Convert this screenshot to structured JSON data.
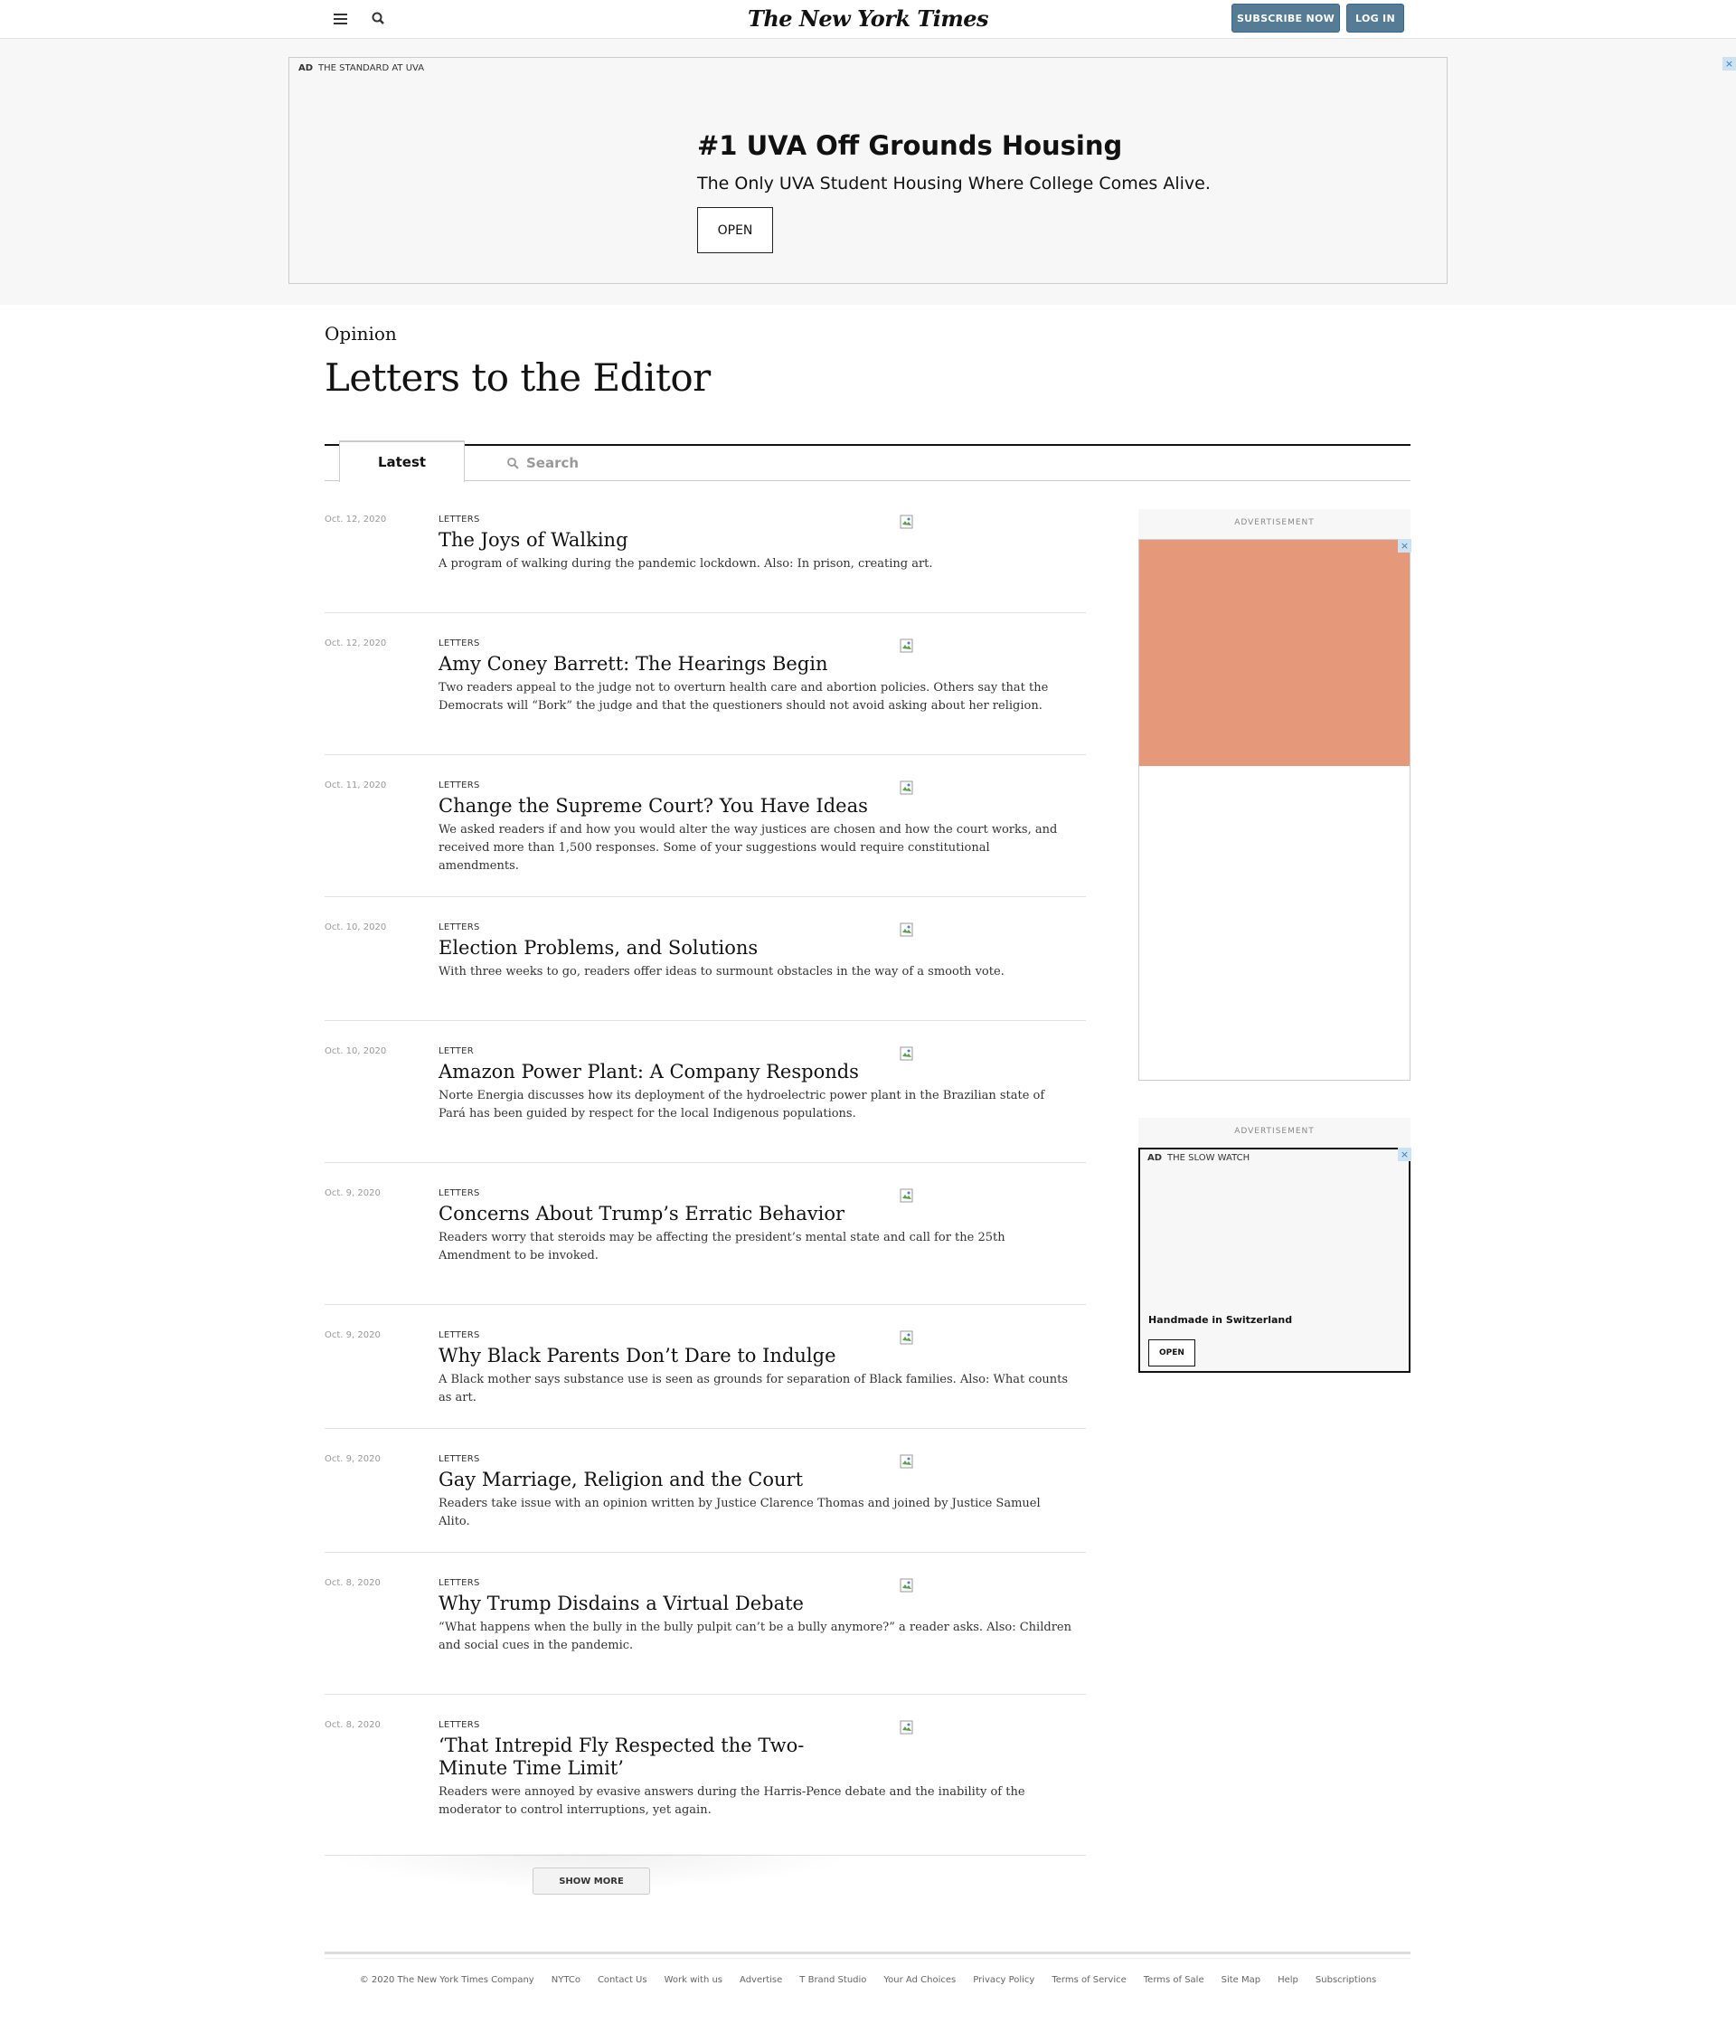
{
  "header": {
    "masthead": "The New York Times",
    "subscribe_label": "SUBSCRIBE NOW",
    "login_label": "LOG IN"
  },
  "top_ad": {
    "ad_tag": "AD",
    "advertiser": "THE STANDARD AT UVA",
    "headline": "#1 UVA Off Grounds Housing",
    "subline": "The Only UVA Student Housing Where College Comes Alive.",
    "cta": "OPEN",
    "close": "×"
  },
  "section": {
    "kicker": "Opinion",
    "title": "Letters to the Editor"
  },
  "tabs": {
    "latest": "Latest",
    "search_placeholder": "Search"
  },
  "articles": [
    {
      "date": "Oct. 12, 2020",
      "kicker": "LETTERS",
      "title": "The Joys of Walking",
      "summary": "A program of walking during the pandemic lockdown. Also: In prison, creating art."
    },
    {
      "date": "Oct. 12, 2020",
      "kicker": "LETTERS",
      "title": "Amy Coney Barrett: The Hearings Begin",
      "summary": "Two readers appeal to the judge not to overturn health care and abortion policies. Others say that the Democrats will “Bork” the judge and that the questioners should not avoid asking about her religion."
    },
    {
      "date": "Oct. 11, 2020",
      "kicker": "LETTERS",
      "title": "Change the Supreme Court? You Have Ideas",
      "summary": "We asked readers if and how you would alter the way justices are chosen and how the court works, and received more than 1,500 responses. Some of your suggestions would require constitutional amendments."
    },
    {
      "date": "Oct. 10, 2020",
      "kicker": "LETTERS",
      "title": "Election Problems, and Solutions",
      "summary": "With three weeks to go, readers offer ideas to surmount obstacles in the way of a smooth vote."
    },
    {
      "date": "Oct. 10, 2020",
      "kicker": "LETTER",
      "title": "Amazon Power Plant: A Company Responds",
      "summary": "Norte Energia discusses how its deployment of the hydroelectric power plant in the Brazilian state of Pará has been guided by respect for the local Indigenous populations."
    },
    {
      "date": "Oct. 9, 2020",
      "kicker": "LETTERS",
      "title": "Concerns About Trump’s Erratic Behavior",
      "summary": "Readers worry that steroids may be affecting the president’s mental state and call for the 25th Amendment to be invoked."
    },
    {
      "date": "Oct. 9, 2020",
      "kicker": "LETTERS",
      "title": "Why Black Parents Don’t Dare to Indulge",
      "summary": "A Black mother says substance use is seen as grounds for separation of Black families. Also: What counts as art."
    },
    {
      "date": "Oct. 9, 2020",
      "kicker": "LETTERS",
      "title": "Gay Marriage, Religion and the Court",
      "summary": "Readers take issue with an opinion written by Justice Clarence Thomas and joined by Justice Samuel Alito."
    },
    {
      "date": "Oct. 8, 2020",
      "kicker": "LETTERS",
      "title": "Why Trump Disdains a Virtual Debate",
      "summary": "“What happens when the bully in the bully pulpit can’t be a bully anymore?” a reader asks. Also: Children and social cues in the pandemic."
    },
    {
      "date": "Oct. 8, 2020",
      "kicker": "LETTERS",
      "title": "‘That Intrepid Fly Respected the Two-Minute Time Limit’",
      "summary": "Readers were annoyed by evasive answers during the Harris-Pence debate and the inability of the moderator to control interruptions, yet again."
    }
  ],
  "show_more": "SHOW MORE",
  "sidebar": {
    "ad1_label": "ADVERTISEMENT",
    "ad2_label": "ADVERTISEMENT",
    "ad2_tag": "AD",
    "ad2_advertiser": "THE SLOW WATCH",
    "ad2_text": "Handmade in Switzerland",
    "ad2_cta": "OPEN",
    "ad1_color": "#e6987b"
  },
  "footer": {
    "copyright": "© 2020 The New York Times Company",
    "links": [
      "NYTCo",
      "Contact Us",
      "Work with us",
      "Advertise",
      "T Brand Studio",
      "Your Ad Choices",
      "Privacy Policy",
      "Terms of Service",
      "Terms of Sale",
      "Site Map",
      "Help",
      "Subscriptions"
    ]
  },
  "colors": {
    "accent_button": "#567b95"
  }
}
